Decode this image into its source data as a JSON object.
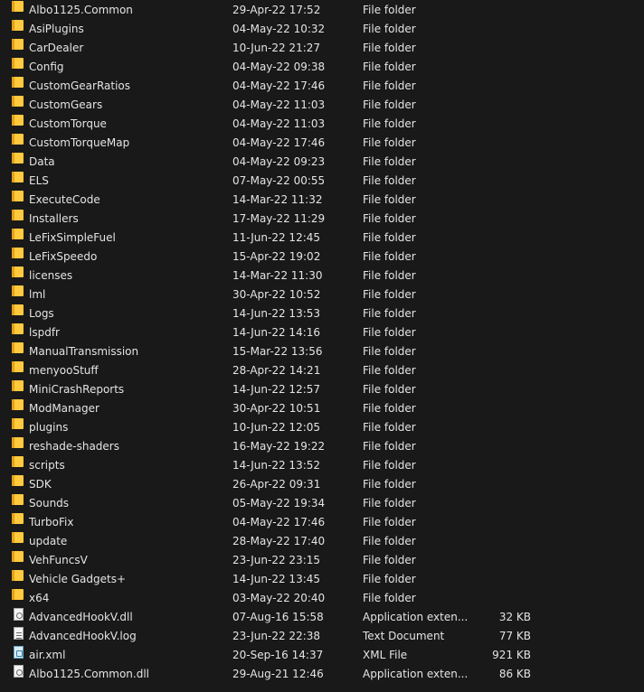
{
  "rows": [
    {
      "name": "Albo1125.Common",
      "date": "29-Apr-22 17:52",
      "type": "File folder",
      "size": "",
      "icon": "folder-icon"
    },
    {
      "name": "AsiPlugins",
      "date": "04-May-22 10:32",
      "type": "File folder",
      "size": "",
      "icon": "folder-icon"
    },
    {
      "name": "CarDealer",
      "date": "10-Jun-22 21:27",
      "type": "File folder",
      "size": "",
      "icon": "folder-icon"
    },
    {
      "name": "Config",
      "date": "04-May-22 09:38",
      "type": "File folder",
      "size": "",
      "icon": "folder-icon"
    },
    {
      "name": "CustomGearRatios",
      "date": "04-May-22 17:46",
      "type": "File folder",
      "size": "",
      "icon": "folder-icon"
    },
    {
      "name": "CustomGears",
      "date": "04-May-22 11:03",
      "type": "File folder",
      "size": "",
      "icon": "folder-icon"
    },
    {
      "name": "CustomTorque",
      "date": "04-May-22 11:03",
      "type": "File folder",
      "size": "",
      "icon": "folder-icon"
    },
    {
      "name": "CustomTorqueMap",
      "date": "04-May-22 17:46",
      "type": "File folder",
      "size": "",
      "icon": "folder-icon"
    },
    {
      "name": "Data",
      "date": "04-May-22 09:23",
      "type": "File folder",
      "size": "",
      "icon": "folder-icon"
    },
    {
      "name": "ELS",
      "date": "07-May-22 00:55",
      "type": "File folder",
      "size": "",
      "icon": "folder-icon"
    },
    {
      "name": "ExecuteCode",
      "date": "14-Mar-22 11:32",
      "type": "File folder",
      "size": "",
      "icon": "folder-icon"
    },
    {
      "name": "Installers",
      "date": "17-May-22 11:29",
      "type": "File folder",
      "size": "",
      "icon": "folder-icon"
    },
    {
      "name": "LeFixSimpleFuel",
      "date": "11-Jun-22 12:45",
      "type": "File folder",
      "size": "",
      "icon": "folder-icon"
    },
    {
      "name": "LeFixSpeedo",
      "date": "15-Apr-22 19:02",
      "type": "File folder",
      "size": "",
      "icon": "folder-icon"
    },
    {
      "name": "licenses",
      "date": "14-Mar-22 11:30",
      "type": "File folder",
      "size": "",
      "icon": "folder-icon"
    },
    {
      "name": "lml",
      "date": "30-Apr-22 10:52",
      "type": "File folder",
      "size": "",
      "icon": "folder-icon"
    },
    {
      "name": "Logs",
      "date": "14-Jun-22 13:53",
      "type": "File folder",
      "size": "",
      "icon": "folder-icon"
    },
    {
      "name": "lspdfr",
      "date": "14-Jun-22 14:16",
      "type": "File folder",
      "size": "",
      "icon": "folder-icon"
    },
    {
      "name": "ManualTransmission",
      "date": "15-Mar-22 13:56",
      "type": "File folder",
      "size": "",
      "icon": "folder-icon"
    },
    {
      "name": "menyooStuff",
      "date": "28-Apr-22 14:21",
      "type": "File folder",
      "size": "",
      "icon": "folder-icon"
    },
    {
      "name": "MiniCrashReports",
      "date": "14-Jun-22 12:57",
      "type": "File folder",
      "size": "",
      "icon": "folder-icon"
    },
    {
      "name": "ModManager",
      "date": "30-Apr-22 10:51",
      "type": "File folder",
      "size": "",
      "icon": "folder-icon"
    },
    {
      "name": "plugins",
      "date": "10-Jun-22 12:05",
      "type": "File folder",
      "size": "",
      "icon": "folder-icon"
    },
    {
      "name": "reshade-shaders",
      "date": "16-May-22 19:22",
      "type": "File folder",
      "size": "",
      "icon": "folder-icon"
    },
    {
      "name": "scripts",
      "date": "14-Jun-22 13:52",
      "type": "File folder",
      "size": "",
      "icon": "folder-icon"
    },
    {
      "name": "SDK",
      "date": "26-Apr-22 09:31",
      "type": "File folder",
      "size": "",
      "icon": "folder-icon"
    },
    {
      "name": "Sounds",
      "date": "05-May-22 19:34",
      "type": "File folder",
      "size": "",
      "icon": "folder-icon"
    },
    {
      "name": "TurboFix",
      "date": "04-May-22 17:46",
      "type": "File folder",
      "size": "",
      "icon": "folder-icon"
    },
    {
      "name": "update",
      "date": "28-May-22 17:40",
      "type": "File folder",
      "size": "",
      "icon": "folder-icon"
    },
    {
      "name": "VehFuncsV",
      "date": "23-Jun-22 23:15",
      "type": "File folder",
      "size": "",
      "icon": "folder-icon"
    },
    {
      "name": "Vehicle Gadgets+",
      "date": "14-Jun-22 13:45",
      "type": "File folder",
      "size": "",
      "icon": "folder-icon"
    },
    {
      "name": "x64",
      "date": "03-May-22 20:40",
      "type": "File folder",
      "size": "",
      "icon": "folder-icon"
    },
    {
      "name": "AdvancedHookV.dll",
      "date": "07-Aug-16 15:58",
      "type": "Application exten...",
      "size": "32 KB",
      "icon": "dll-file-icon"
    },
    {
      "name": "AdvancedHookV.log",
      "date": "23-Jun-22 22:38",
      "type": "Text Document",
      "size": "77 KB",
      "icon": "text-file-icon"
    },
    {
      "name": "air.xml",
      "date": "20-Sep-16 14:37",
      "type": "XML File",
      "size": "921 KB",
      "icon": "xml-file-icon"
    },
    {
      "name": "Albo1125.Common.dll",
      "date": "29-Aug-21 12:46",
      "type": "Application exten...",
      "size": "86 KB",
      "icon": "dll-file-icon"
    }
  ]
}
